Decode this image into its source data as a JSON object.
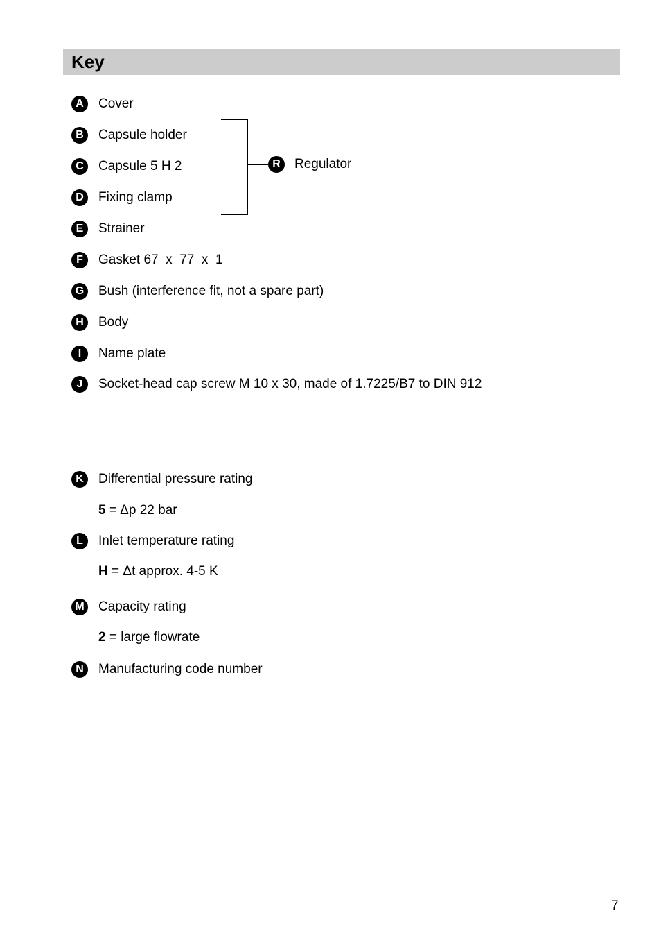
{
  "header": {
    "title": "Key"
  },
  "items": [
    {
      "letter": "A",
      "text": "Cover"
    },
    {
      "letter": "B",
      "text": "Capsule holder"
    },
    {
      "letter": "C",
      "text": "Capsule 5 H 2"
    },
    {
      "letter": "D",
      "text": "Fixing clamp"
    },
    {
      "letter": "E",
      "text": "Strainer"
    },
    {
      "letter": "F",
      "text": "Gasket 67  x  77  x  1"
    },
    {
      "letter": "G",
      "text": "Bush (interference fit, not a spare part)"
    },
    {
      "letter": "H",
      "text": "Body"
    },
    {
      "letter": "I",
      "text": "Name plate"
    },
    {
      "letter": "J",
      "text": "Socket-head cap screw M 10 x 30, made of 1.7225/B7 to DIN 912"
    }
  ],
  "group": {
    "letter": "R",
    "text": "Regulator"
  },
  "ratings": [
    {
      "letter": "K",
      "text": "Differential pressure rating",
      "code": "5",
      "detail": " = Δp 22 bar"
    },
    {
      "letter": "L",
      "text": "Inlet temperature rating",
      "code": "H",
      "detail": " = Δt approx. 4-5 K"
    },
    {
      "letter": "M",
      "text": "Capacity rating",
      "code": "2",
      "detail": " = large flowrate"
    },
    {
      "letter": "N",
      "text": "Manufacturing code number"
    }
  ],
  "page_number": "7"
}
